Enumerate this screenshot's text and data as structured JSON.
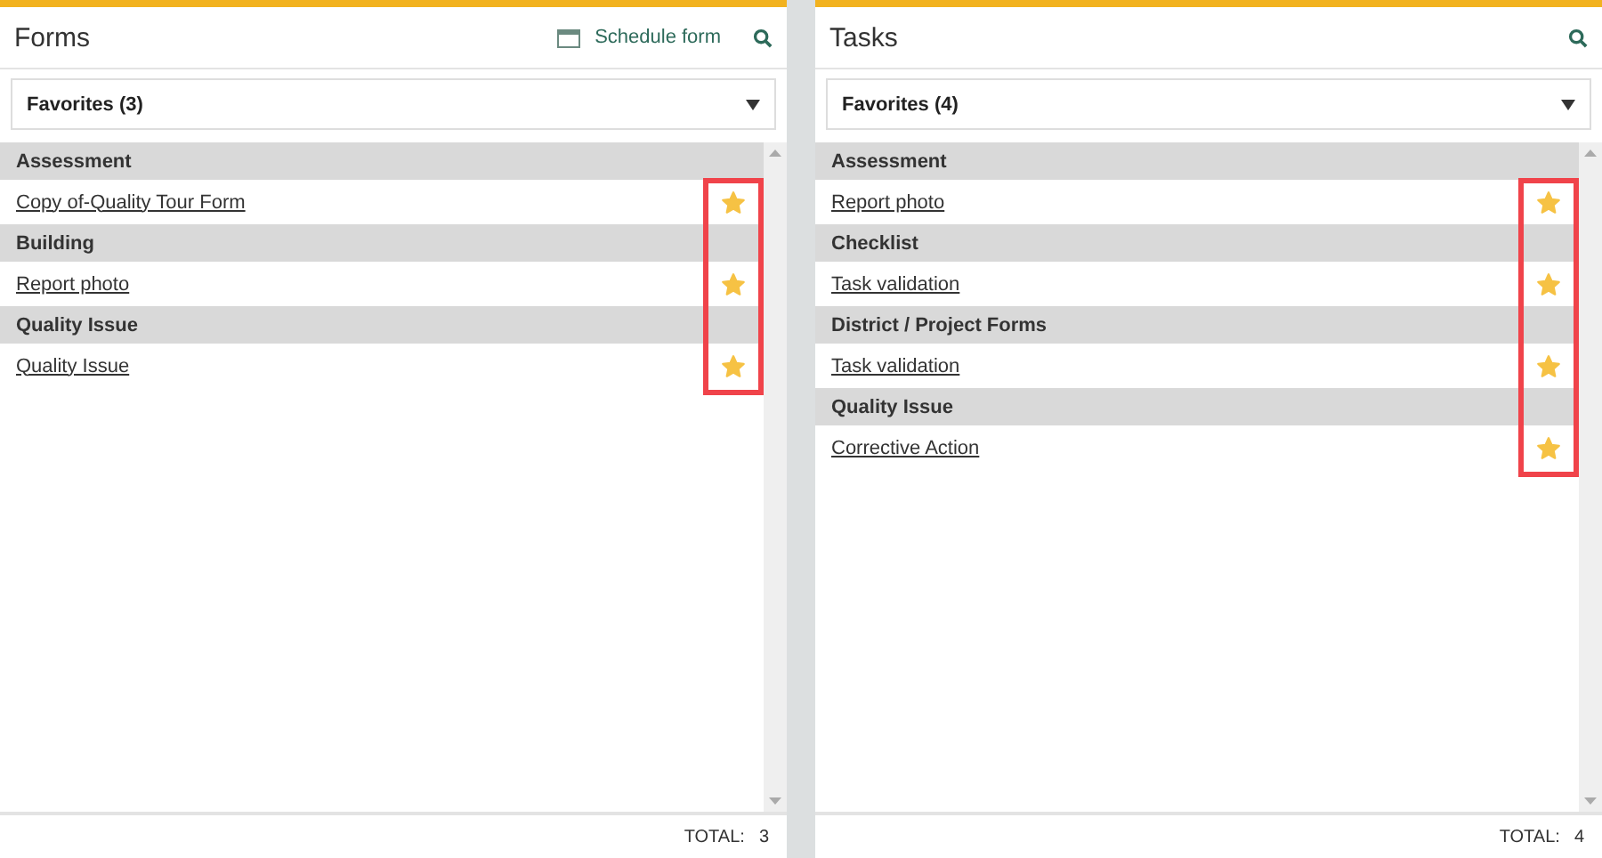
{
  "panels": [
    {
      "title": "Forms",
      "schedule_button": "Schedule form",
      "dropdown": "Favorites (3)",
      "highlight_stars": true,
      "groups": [
        {
          "name": "Assessment",
          "items": [
            {
              "label": "Copy of-Quality Tour Form",
              "favorite": true
            }
          ]
        },
        {
          "name": "Building",
          "items": [
            {
              "label": "Report photo",
              "favorite": true
            }
          ]
        },
        {
          "name": "Quality Issue",
          "items": [
            {
              "label": "Quality Issue",
              "favorite": true
            }
          ]
        }
      ],
      "total_label": "TOTAL:",
      "total": "3"
    },
    {
      "title": "Tasks",
      "dropdown": "Favorites (4)",
      "highlight_stars": true,
      "groups": [
        {
          "name": "Assessment",
          "items": [
            {
              "label": "Report photo",
              "favorite": true
            }
          ]
        },
        {
          "name": "Checklist",
          "items": [
            {
              "label": "Task validation",
              "favorite": true
            }
          ]
        },
        {
          "name": "District / Project Forms",
          "items": [
            {
              "label": "Task validation",
              "favorite": true
            }
          ]
        },
        {
          "name": "Quality Issue",
          "items": [
            {
              "label": "Corrective Action",
              "favorite": true
            }
          ]
        }
      ],
      "total_label": "TOTAL:",
      "total": "4"
    }
  ]
}
